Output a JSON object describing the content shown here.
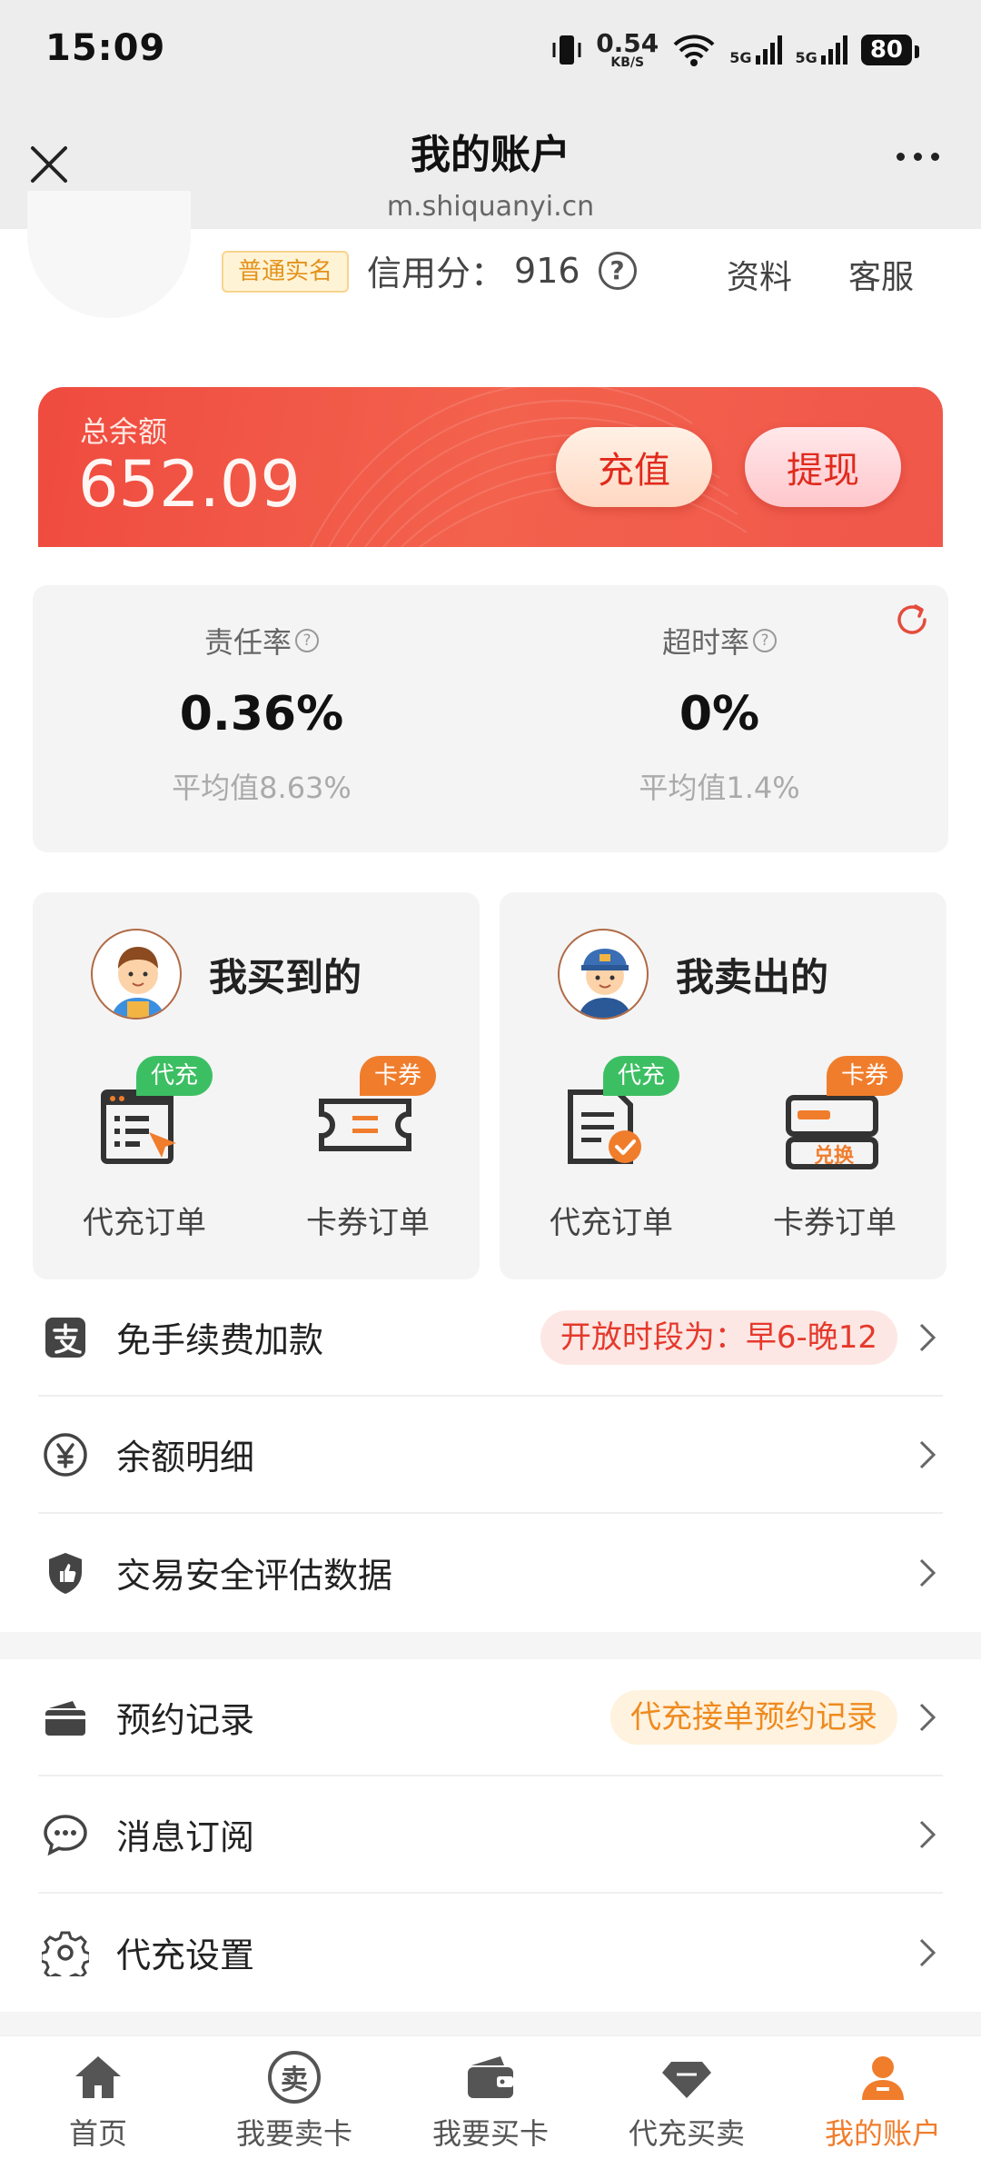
{
  "status_bar": {
    "time": "15:09",
    "net_speed": "0.54",
    "net_unit": "KB/S",
    "battery": "80",
    "signal1": "5G",
    "signal2": "5G"
  },
  "header": {
    "title": "我的账户",
    "url": "m.shiquanyi.cn"
  },
  "profile": {
    "verify_badge": "普通实名",
    "credit_label": "信用分：",
    "credit_score": "916",
    "help_mark": "?",
    "link_profile": "资料",
    "link_service": "客服"
  },
  "balance": {
    "label": "总余额",
    "value": "652.09",
    "recharge_label": "充值",
    "withdraw_label": "提现"
  },
  "stats": {
    "left": {
      "label": "责任率",
      "value": "0.36%",
      "avg": "平均值8.63%"
    },
    "right": {
      "label": "超时率",
      "value": "0%",
      "avg": "平均值1.4%"
    },
    "q": "?"
  },
  "orders": {
    "buy": {
      "title": "我买到的",
      "items": [
        {
          "tag": "代充",
          "label": "代充订单"
        },
        {
          "tag": "卡券",
          "label": "卡券订单"
        }
      ]
    },
    "sell": {
      "title": "我卖出的",
      "items": [
        {
          "tag": "代充",
          "label": "代充订单"
        },
        {
          "tag": "卡券",
          "label": "卡券订单",
          "icon_text": "兑换"
        }
      ]
    }
  },
  "menu1": [
    {
      "label": "免手续费加款",
      "tag": "开放时段为：早6-晚12",
      "icon": "alipay-icon"
    },
    {
      "label": "余额明细",
      "icon": "yuan-icon"
    },
    {
      "label": "交易安全评估数据",
      "icon": "shield-icon"
    }
  ],
  "menu2": [
    {
      "label": "预约记录",
      "tag": "代充接单预约记录",
      "icon": "card-icon"
    },
    {
      "label": "消息订阅",
      "icon": "chat-icon"
    },
    {
      "label": "代充设置",
      "icon": "gear-icon"
    }
  ],
  "tabs": [
    {
      "label": "首页",
      "icon": "home-icon"
    },
    {
      "label": "我要卖卡",
      "icon": "sell-icon",
      "icon_text": "卖"
    },
    {
      "label": "我要买卡",
      "icon": "wallet-icon"
    },
    {
      "label": "代充买卖",
      "icon": "diamond-icon"
    },
    {
      "label": "我的账户",
      "icon": "user-icon"
    }
  ],
  "colors": {
    "accent": "#f07d2c",
    "balance_card": "#ef4b3f",
    "tag_green": "#3cbf62",
    "tag_red_text": "#e5392c"
  }
}
